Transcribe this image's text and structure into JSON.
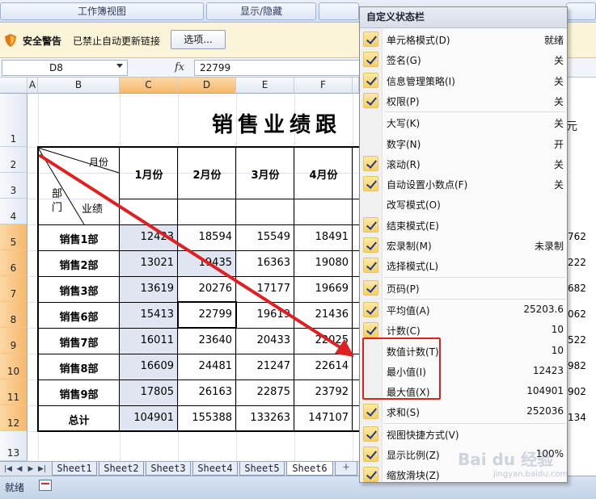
{
  "ribbon": {
    "groups": [
      "工作簿视图",
      "显示/隐藏",
      ""
    ]
  },
  "security": {
    "title": "安全警告",
    "message": "已禁止自动更新链接",
    "button": "选项..."
  },
  "formula_bar": {
    "name_box": "D8",
    "fx_label": "fx",
    "value": "22799"
  },
  "columns": [
    "A",
    "B",
    "C",
    "D",
    "E",
    "F"
  ],
  "rows": [
    "1",
    "2",
    "3",
    "4",
    "5",
    "6",
    "7",
    "8",
    "9",
    "10",
    "11",
    "12",
    "13"
  ],
  "sheet": {
    "title": "销售业绩跟",
    "title_right": "元",
    "header_month": "月份",
    "header_dept": "部门",
    "header_perf": "业绩",
    "months": [
      "1月份",
      "2月份",
      "3月份",
      "4月份"
    ],
    "rows": [
      {
        "dept": "销售1部",
        "values": [
          "12423",
          "18594",
          "15549",
          "18491"
        ],
        "right": "762"
      },
      {
        "dept": "销售2部",
        "values": [
          "13021",
          "19435",
          "16363",
          "19080"
        ],
        "right": "222"
      },
      {
        "dept": "销售3部",
        "values": [
          "13619",
          "20276",
          "17177",
          "19669"
        ],
        "right": "682"
      },
      {
        "dept": "销售6部",
        "values": [
          "15413",
          "22799",
          "19619",
          "21436"
        ],
        "right": "062"
      },
      {
        "dept": "销售7部",
        "values": [
          "16011",
          "23640",
          "20433",
          "22025"
        ],
        "right": "522"
      },
      {
        "dept": "销售8部",
        "values": [
          "16609",
          "24481",
          "21247",
          "22614"
        ],
        "right": "982"
      },
      {
        "dept": "销售9部",
        "values": [
          "17805",
          "26163",
          "22875",
          "23792"
        ],
        "right": "902"
      },
      {
        "dept": "总计",
        "values": [
          "104901",
          "155388",
          "133263",
          "147107"
        ],
        "right": "134"
      }
    ]
  },
  "sheet_tabs": [
    "Sheet1",
    "Sheet2",
    "Sheet3",
    "Sheet4",
    "Sheet5",
    "Sheet6"
  ],
  "active_sheet": "Sheet6",
  "status": {
    "ready": "就绪"
  },
  "menu": {
    "title": "自定义状态栏",
    "items": [
      {
        "label": "单元格模式(D)",
        "value": "就绪",
        "checked": true
      },
      {
        "label": "签名(G)",
        "value": "关",
        "checked": true
      },
      {
        "label": "信息管理策略(I)",
        "value": "关",
        "checked": true
      },
      {
        "label": "权限(P)",
        "value": "关",
        "checked": true
      },
      {
        "label": "大写(K)",
        "value": "关",
        "checked": false
      },
      {
        "label": "数字(N)",
        "value": "开",
        "checked": false
      },
      {
        "label": "滚动(R)",
        "value": "关",
        "checked": true
      },
      {
        "label": "自动设置小数点(F)",
        "value": "关",
        "checked": true
      },
      {
        "label": "改写模式(O)",
        "value": "",
        "checked": false
      },
      {
        "label": "结束模式(E)",
        "value": "",
        "checked": true
      },
      {
        "label": "宏录制(M)",
        "value": "未录制",
        "checked": true
      },
      {
        "label": "选择模式(L)",
        "value": "",
        "checked": true
      },
      {
        "label": "页码(P)",
        "value": "",
        "checked": true
      },
      {
        "label": "平均值(A)",
        "value": "25203.6",
        "checked": true
      },
      {
        "label": "计数(C)",
        "value": "10",
        "checked": true
      },
      {
        "label": "数值计数(T)",
        "value": "10",
        "checked": false
      },
      {
        "label": "最小值(I)",
        "value": "12423",
        "checked": false
      },
      {
        "label": "最大值(X)",
        "value": "104901",
        "checked": false
      },
      {
        "label": "求和(S)",
        "value": "252036",
        "checked": true
      },
      {
        "label": "视图快捷方式(V)",
        "value": "",
        "checked": true
      },
      {
        "label": "显示比例(Z)",
        "value": "100%",
        "checked": true
      },
      {
        "label": "缩放滑块(Z)",
        "value": "",
        "checked": true
      }
    ]
  },
  "watermark": {
    "text": "Bai du 经验",
    "sub": "jingyan.baidu.com"
  },
  "colors": {
    "accent_red": "#e02020",
    "check_bg": "#f8cf62",
    "selected_header": "#f5b86c"
  }
}
